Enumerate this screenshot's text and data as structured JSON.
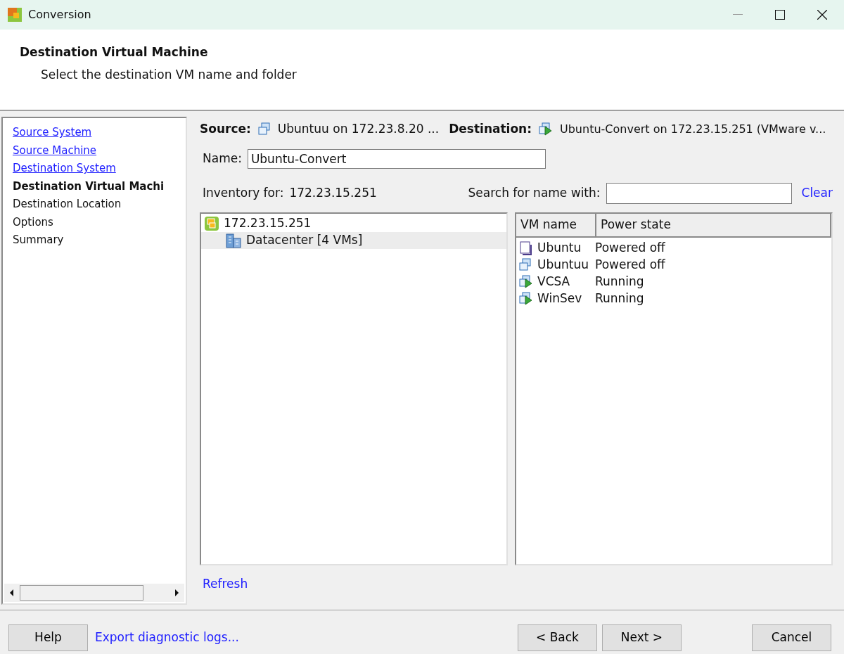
{
  "window": {
    "title": "Conversion"
  },
  "header": {
    "title": "Destination Virtual Machine",
    "subtitle": "Select the destination VM name and folder"
  },
  "steps": [
    {
      "label": "Source System",
      "link": true,
      "selected": false
    },
    {
      "label": "Source Machine",
      "link": true,
      "selected": false
    },
    {
      "label": "Destination System",
      "link": true,
      "selected": false
    },
    {
      "label": "Destination Virtual Machi",
      "link": false,
      "selected": true
    },
    {
      "label": "Destination Location",
      "link": false,
      "selected": false
    },
    {
      "label": "Options",
      "link": false,
      "selected": false
    },
    {
      "label": "Summary",
      "link": false,
      "selected": false
    }
  ],
  "summary": {
    "source_label": "Source:",
    "source": "Ubuntuu on 172.23.8.20 ...",
    "destination_label": "Destination:",
    "destination": "Ubuntu-Convert on 172.23.15.251 (VMware v..."
  },
  "name": {
    "label": "Name:",
    "value": "Ubuntu-Convert"
  },
  "inventory": {
    "label": "Inventory for:",
    "host": "172.23.15.251"
  },
  "search": {
    "label": "Search for name with:",
    "clear": "Clear"
  },
  "tree": [
    {
      "label": "172.23.15.251",
      "selected": false,
      "children": [
        {
          "label": "Datacenter [4 VMs]",
          "selected": true
        }
      ]
    }
  ],
  "vm_table": {
    "columns": [
      "VM name",
      "Power state"
    ],
    "rows": [
      {
        "kind": "template",
        "name": "Ubuntu",
        "power": "Powered off"
      },
      {
        "kind": "vm",
        "name": "Ubuntuu",
        "power": "Powered off"
      },
      {
        "kind": "running",
        "name": "VCSA",
        "power": "Running"
      },
      {
        "kind": "running",
        "name": "WinSev",
        "power": "Running"
      }
    ]
  },
  "refresh": "Refresh",
  "footer": {
    "help": "Help",
    "export": "Export diagnostic logs...",
    "back": "< Back",
    "next": "Next >",
    "cancel": "Cancel"
  }
}
